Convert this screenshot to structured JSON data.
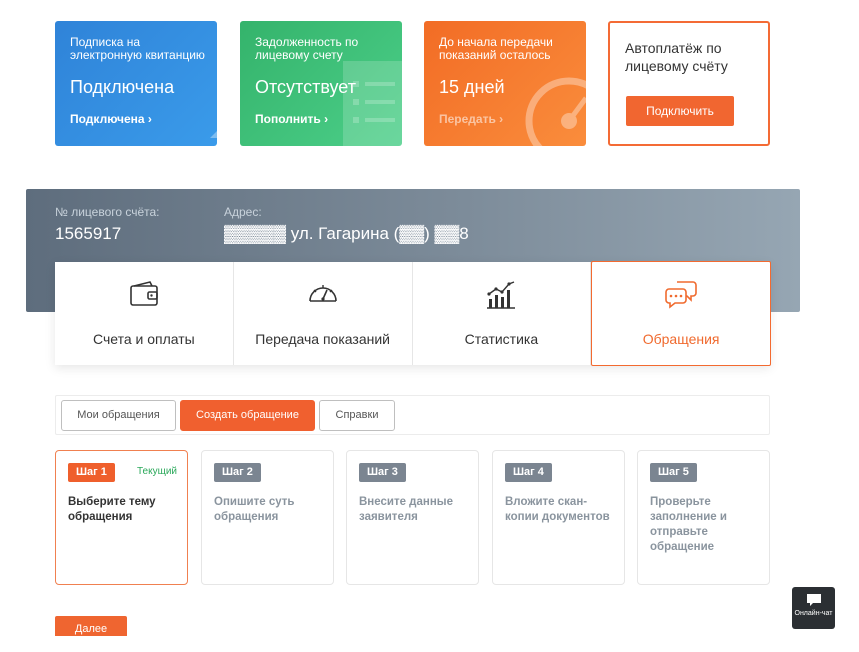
{
  "cards": {
    "subscription": {
      "title": "Подписка на электронную квитанцию",
      "value": "Подключена",
      "link": "Подключена ›"
    },
    "debt": {
      "title": "Задолженность по лицевому счету",
      "value": "Отсутствует",
      "link": "Пополнить ›"
    },
    "readings": {
      "title": "До начала передачи показаний осталось",
      "value": "15 дней",
      "link": "Передать ›"
    },
    "autopay": {
      "title": "Автоплатёж по лицевому счёту",
      "button": "Подключить"
    }
  },
  "account": {
    "number_label": "№ лицевого счёта:",
    "number": "1565917",
    "address_label": "Адрес:",
    "address": "▓▓▓▓▓ ул. Гагарина (▓▓) ▓▓8"
  },
  "tabs": [
    {
      "label": "Счета и оплаты",
      "icon": "wallet-icon"
    },
    {
      "label": "Передача показаний",
      "icon": "gauge-icon"
    },
    {
      "label": "Статистика",
      "icon": "stats-icon"
    },
    {
      "label": "Обращения",
      "icon": "chat-bubbles-icon"
    }
  ],
  "subtabs": [
    "Мои обращения",
    "Создать обращение",
    "Справки"
  ],
  "steps": [
    {
      "badge": "Шаг 1",
      "current": "Текущий",
      "text": "Выберите тему обращения"
    },
    {
      "badge": "Шаг 2",
      "text": "Опишите суть обращения"
    },
    {
      "badge": "Шаг 3",
      "text": "Внесите данные заявителя"
    },
    {
      "badge": "Шаг 4",
      "text": "Вложите скан-копии документов"
    },
    {
      "badge": "Шаг 5",
      "text": "Проверьте заполнение и отправьте обращение"
    }
  ],
  "next_button": "Далее",
  "chat": {
    "label": "Онлайн-чат"
  },
  "colors": {
    "accent": "#f16630",
    "blue": "#2f83d8",
    "green": "#34b36b",
    "orange": "#f26c25",
    "banner": "#6b7a89"
  }
}
